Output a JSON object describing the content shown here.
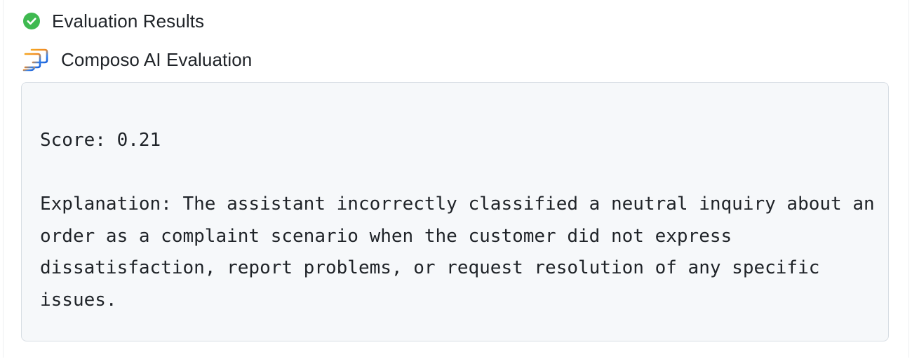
{
  "status": {
    "icon": "check-circle-icon",
    "title": "Evaluation Results",
    "color": "#3fb950"
  },
  "provider": {
    "icon": "composo-logo-icon",
    "title": "Composo AI Evaluation"
  },
  "result": {
    "score_label": "Score:",
    "score_value": "0.21",
    "explanation_label": "Explanation:",
    "explanation_text": "The assistant incorrectly classified a neutral inquiry about an order as a complaint scenario when the customer did not express dissatisfaction, report problems, or request resolution of any specific issues."
  }
}
